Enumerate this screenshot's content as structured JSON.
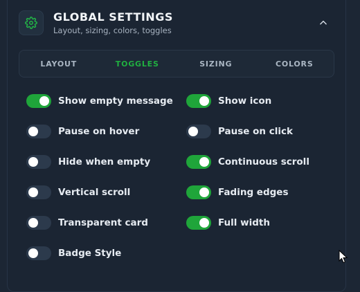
{
  "header": {
    "title": "GLOBAL SETTINGS",
    "subtitle": "Layout, sizing, colors, toggles",
    "icon": "gear-icon",
    "collapse_icon": "chevron-up-icon"
  },
  "tabs": [
    {
      "label": "LAYOUT",
      "active": false
    },
    {
      "label": "TOGGLES",
      "active": true
    },
    {
      "label": "SIZING",
      "active": false
    },
    {
      "label": "COLORS",
      "active": false
    }
  ],
  "toggles_left": [
    {
      "label": "Show empty message",
      "on": true
    },
    {
      "label": "Pause on hover",
      "on": false
    },
    {
      "label": "Hide when empty",
      "on": false
    },
    {
      "label": "Vertical scroll",
      "on": false
    },
    {
      "label": "Transparent card",
      "on": false
    },
    {
      "label": "Badge Style",
      "on": false
    }
  ],
  "toggles_right": [
    {
      "label": "Show icon",
      "on": true
    },
    {
      "label": "Pause on click",
      "on": false
    },
    {
      "label": "Continuous scroll",
      "on": true
    },
    {
      "label": "Fading edges",
      "on": true
    },
    {
      "label": "Full width",
      "on": true
    }
  ],
  "colors": {
    "accent": "#1fa53a",
    "active_tab": "#20b040",
    "background": "#1b2533"
  }
}
